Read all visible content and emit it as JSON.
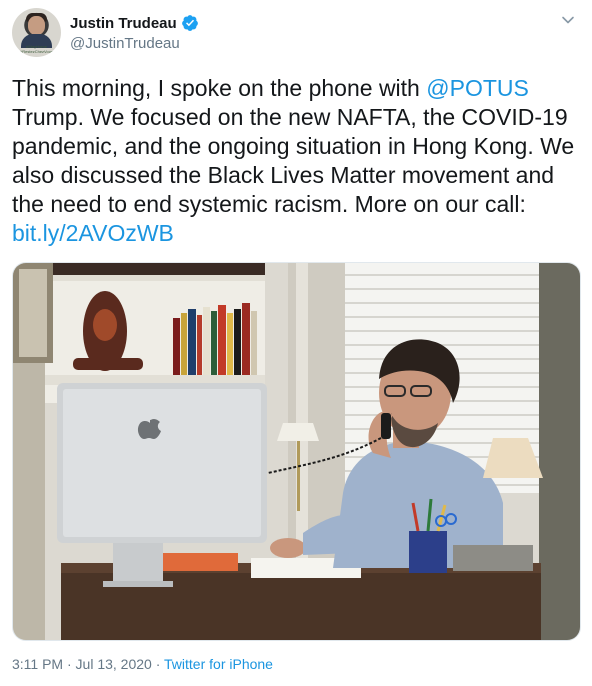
{
  "tweet": {
    "display_name": "Justin Trudeau",
    "handle": "@JustinTrudeau",
    "avatar_caption": "#StayHome #RestezChezVous",
    "text_part1": "This morning, I spoke on the phone with ",
    "mention": "@POTUS",
    "text_part2": "\nTrump. We focused on the new NAFTA, the COVID-19 pandemic, and the ongoing situation in Hong Kong. We also discussed the Black Lives Matter movement and the need to end systemic racism. More on our call:\n",
    "link": "bit.ly/2AVOzWB",
    "timestamp": "3:11 PM · Jul 13, 2020",
    "separator": " · ",
    "source": "Twitter for iPhone"
  },
  "icons": {
    "verified": "verified-badge-icon",
    "caret": "chevron-down-icon"
  },
  "colors": {
    "link": "#1b95e0",
    "verified": "#1da1f2",
    "secondary_text": "#657786"
  }
}
